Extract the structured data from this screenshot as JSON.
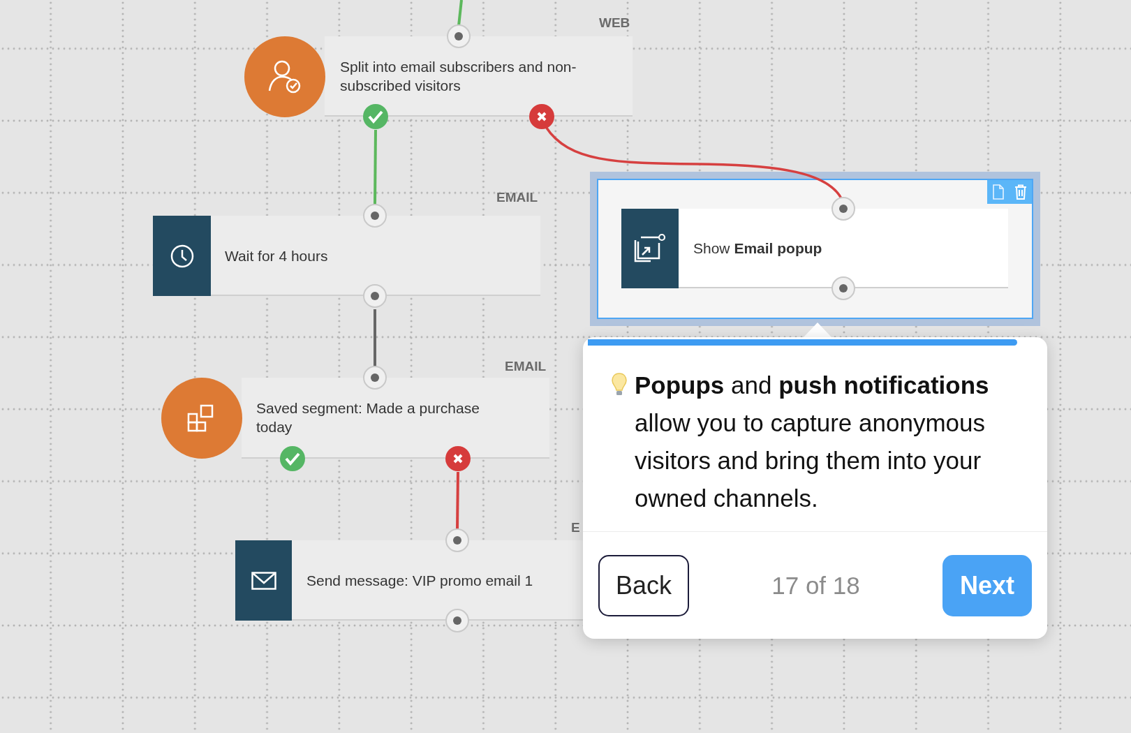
{
  "nodes": [
    {
      "kind": "subscriber_split",
      "channel": "WEB",
      "text": "Split into email subscribers and non-subscribed visitors",
      "selected": false
    },
    {
      "kind": "wait",
      "channel": "EMAIL",
      "text": "Wait for 4 hours",
      "selected": false
    },
    {
      "kind": "segment_split",
      "channel": "EMAIL",
      "text": "Saved segment: Made a purchase today",
      "selected": false
    },
    {
      "kind": "send_email",
      "channel": "E",
      "text": "Send message: VIP promo email 1",
      "selected": false
    },
    {
      "kind": "show_popup",
      "text": "Show **Email popup**",
      "selected": true
    }
  ],
  "tooltip": {
    "level": 0.944,
    "text": "**Popups** and **push notifications** allow you to capture anonymous visitors and bring them into your owned channels.",
    "step": "17 of 18",
    "buttons": [
      {
        "label": "Back",
        "kind": "secondary"
      },
      {
        "label": "Next",
        "kind": "primary"
      }
    ]
  }
}
